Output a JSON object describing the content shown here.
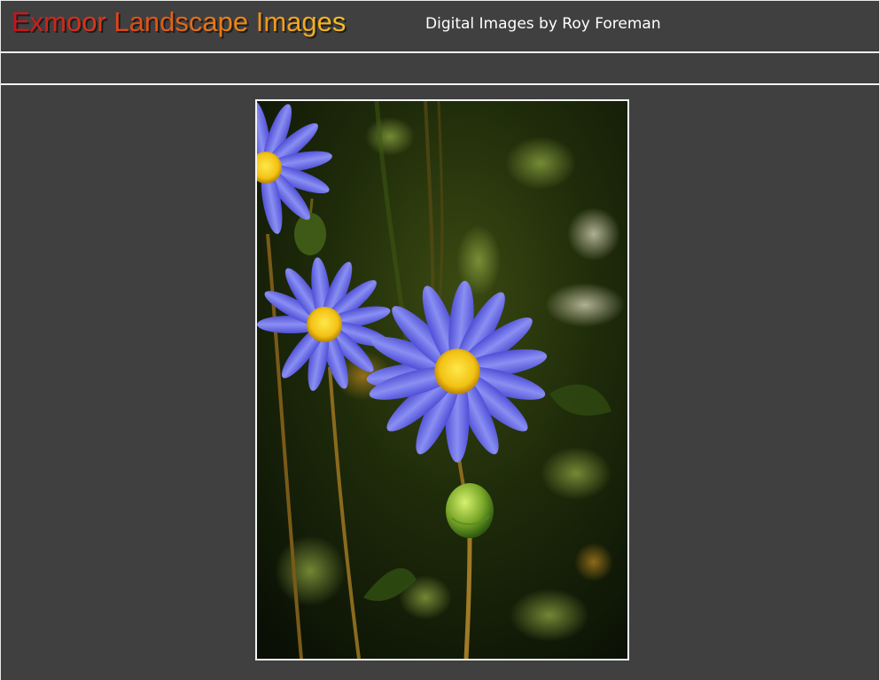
{
  "header": {
    "title": "Exmoor Landscape Images",
    "subtitle": "Digital Images by Roy Foreman"
  },
  "colors": {
    "background": "#404040",
    "title_gradient_start": "#c8121a",
    "title_gradient_end": "#f6c121",
    "rule": "#f2f2f2",
    "subtitle": "#ffffff"
  },
  "photo": {
    "subject_icon": "blue-daisy-photo"
  }
}
